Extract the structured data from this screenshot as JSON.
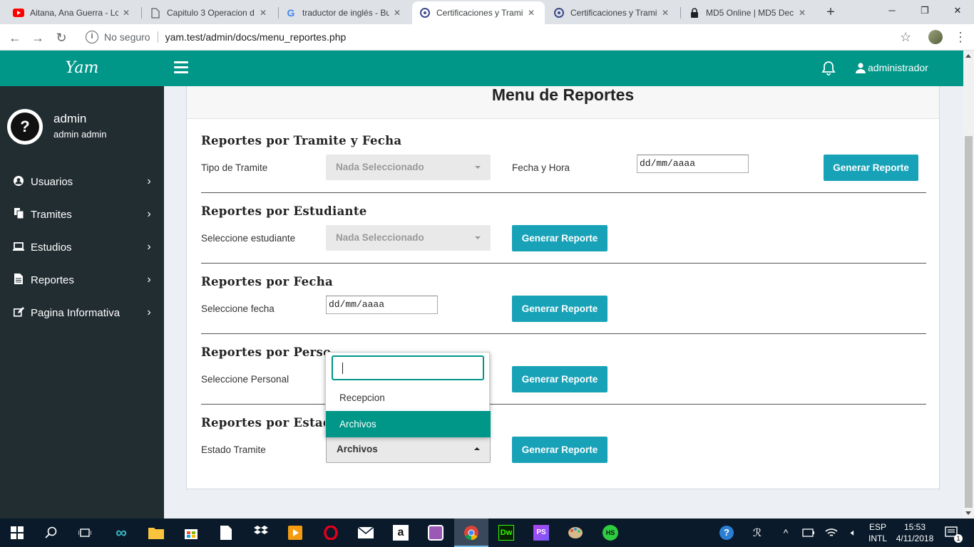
{
  "browser": {
    "tabs": [
      {
        "title": "Aitana, Ana Guerra - Lo",
        "icon": "youtube-icon"
      },
      {
        "title": "Capitulo 3 Operacion d",
        "icon": "document-icon"
      },
      {
        "title": "traductor de inglés - Bu",
        "icon": "google-icon"
      },
      {
        "title": "Certificaciones y Tramite",
        "icon": "site-icon"
      },
      {
        "title": "Certificaciones y Tramite",
        "icon": "site-icon"
      },
      {
        "title": "MD5 Online | MD5 Dec",
        "icon": "lock-icon"
      }
    ],
    "active_tab": 3,
    "security_label": "No seguro",
    "url": "yam.test/admin/docs/menu_reportes.php"
  },
  "app": {
    "brand": "Yam",
    "accent_color": "#009688",
    "sidebar_color": "#222d32",
    "user": {
      "name": "admin",
      "fullname": "admin admin"
    },
    "menu": [
      {
        "label": "Usuarios",
        "icon": "user-circle-icon"
      },
      {
        "label": "Tramites",
        "icon": "files-icon"
      },
      {
        "label": "Estudios",
        "icon": "laptop-icon"
      },
      {
        "label": "Reportes",
        "icon": "file-text-icon"
      },
      {
        "label": "Pagina Informativa",
        "icon": "edit-icon"
      }
    ],
    "topnav": {
      "username": "administrador"
    }
  },
  "page": {
    "title": "Menu de Reportes",
    "sections": {
      "tramite_fecha": {
        "title": "Reportes por Tramite y Fecha",
        "label": "Tipo de Tramite",
        "select_value": "Nada Seleccionado",
        "datetime_label": "Fecha y Hora",
        "date_value": "dd/mm/aaaa",
        "button": "Generar Reporte"
      },
      "estudiante": {
        "title": "Reportes por Estudiante",
        "label": "Seleccione estudiante",
        "select_value": "Nada Seleccionado",
        "button": "Generar Reporte"
      },
      "fecha": {
        "title": "Reportes por Fecha",
        "label": "Seleccione fecha",
        "date_value": "dd/mm/aaaa",
        "button": "Generar Reporte"
      },
      "personal": {
        "title": "Reportes por Perso",
        "label": "Seleccione Personal",
        "button": "Generar Reporte"
      },
      "estado": {
        "title": "Reportes por Estad",
        "label": "Estado Tramite",
        "select_value": "Archivos",
        "button": "Generar Reporte"
      }
    },
    "dropdown": {
      "search_value": "",
      "options": [
        "Recepcion",
        "Archivos"
      ],
      "highlighted": "Archivos"
    },
    "button_color": "#17a2b8"
  },
  "taskbar": {
    "language": "ESP",
    "layout": "INTL",
    "time": "15:53",
    "date": "4/11/2018",
    "notifications": "1"
  }
}
